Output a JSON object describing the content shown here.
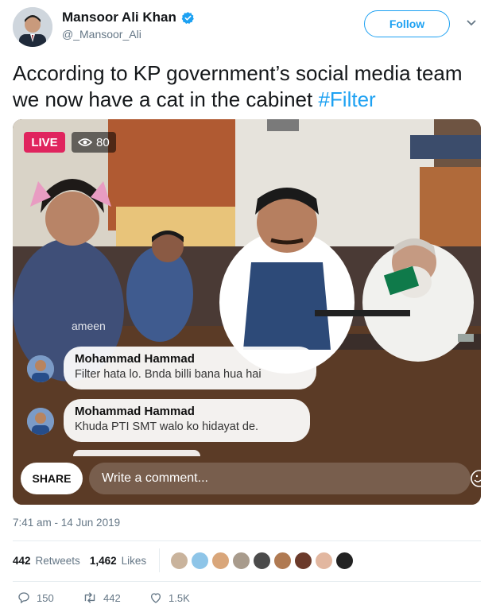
{
  "author": {
    "name": "Mansoor Ali Khan",
    "handle": "@_Mansoor_Ali",
    "verified": true
  },
  "follow_label": "Follow",
  "tweet": {
    "text": "According to KP government’s social media team we now have a cat in the cabinet ",
    "hashtag": "#Filter"
  },
  "live_video": {
    "live_label": "LIVE",
    "viewer_count": "80",
    "faded_comment": "ameen",
    "comments": [
      {
        "name": "Mohammad Hammad",
        "text": "Filter hata lo. Bnda billi bana hua hai"
      },
      {
        "name": "Mohammad Hammad",
        "text": "Khuda PTI SMT walo ko hidayat de."
      }
    ],
    "share_label": "SHARE",
    "comment_placeholder": "Write a comment..."
  },
  "timestamp": "7:41 am - 14 Jun 2019",
  "stats": {
    "retweets_count": "442",
    "retweets_label": "Retweets",
    "likes_count": "1,462",
    "likes_label": "Likes"
  },
  "liker_colors": [
    "#c9b39c",
    "#8ec5e8",
    "#d9a67a",
    "#a89b8c",
    "#4b4b4b",
    "#b07a52",
    "#6b3a2a",
    "#e2b7a0",
    "#222222"
  ],
  "actions": {
    "replies": "150",
    "retweets": "442",
    "likes": "1.5K"
  },
  "colors": {
    "accent": "#1da1f2",
    "live": "#e0245e"
  }
}
